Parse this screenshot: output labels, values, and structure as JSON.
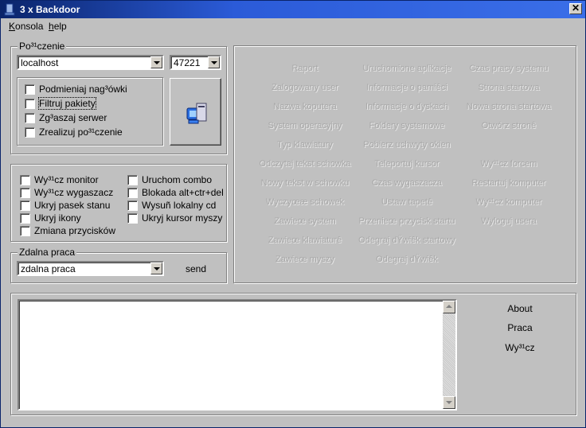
{
  "window": {
    "title": "3 x Backdoor",
    "close": "✕"
  },
  "menu": {
    "items": [
      "Konsola",
      "help"
    ]
  },
  "connection": {
    "legend": "Po³¹czenie",
    "host": "localhost",
    "port": "47221",
    "options": [
      "Podmieniaj nag³ówki",
      "Filtruj pakiety",
      "Zg³aszaj serwer",
      "Zrealizuj po³¹czenie"
    ]
  },
  "actions_left": [
    "Wy³¹cz monitor",
    "Wy³¹cz wygaszacz",
    "Ukryj  pasek stanu",
    "Ukryj ikony",
    "Zmiana przycisków"
  ],
  "actions_right": [
    "Uruchom combo",
    "Blokada alt+ctr+del",
    "Wysuñ lokalny cd",
    "Ukryj kursor myszy"
  ],
  "remote": {
    "legend": "Zdalna praca",
    "value": "zdalna praca",
    "send": "send"
  },
  "commands": {
    "col1": [
      "Raport",
      "Zalogowany user",
      "Nazwa koputera",
      "System operacyjny",
      "Typ klawiatury",
      "Odczytaj tekst schowka",
      "Nowy tekst w schowku",
      "Wyczyœæ schowek",
      "Zawieœ system",
      "Zawieœ klawiaturê",
      "Zawieœ myszy"
    ],
    "col2": [
      "Uruchomione aplikacje",
      "Informacje o pamiêci",
      "Informacje o dyskach",
      "Foldery systemowe",
      "Pobierz uchwyty okien",
      "Teleportuj kursor",
      "Czas wygaszacza",
      "Ustaw tapetê",
      "Przenieœ przycisk startu",
      "Odegraj dŸwiêk startowy",
      "Odegraj dŸwiêk"
    ],
    "col3": [
      "Czas pracy systemu",
      "Strona startowa",
      "Nowa strona startowa",
      "Otwórz stronê",
      "",
      "Wy³¹cz forcem",
      "Restartuj komputer",
      "Wy³¹cz komputer",
      "Wyloguj usera"
    ]
  },
  "side_buttons": [
    "About",
    "Praca",
    "Wy³¹cz"
  ]
}
